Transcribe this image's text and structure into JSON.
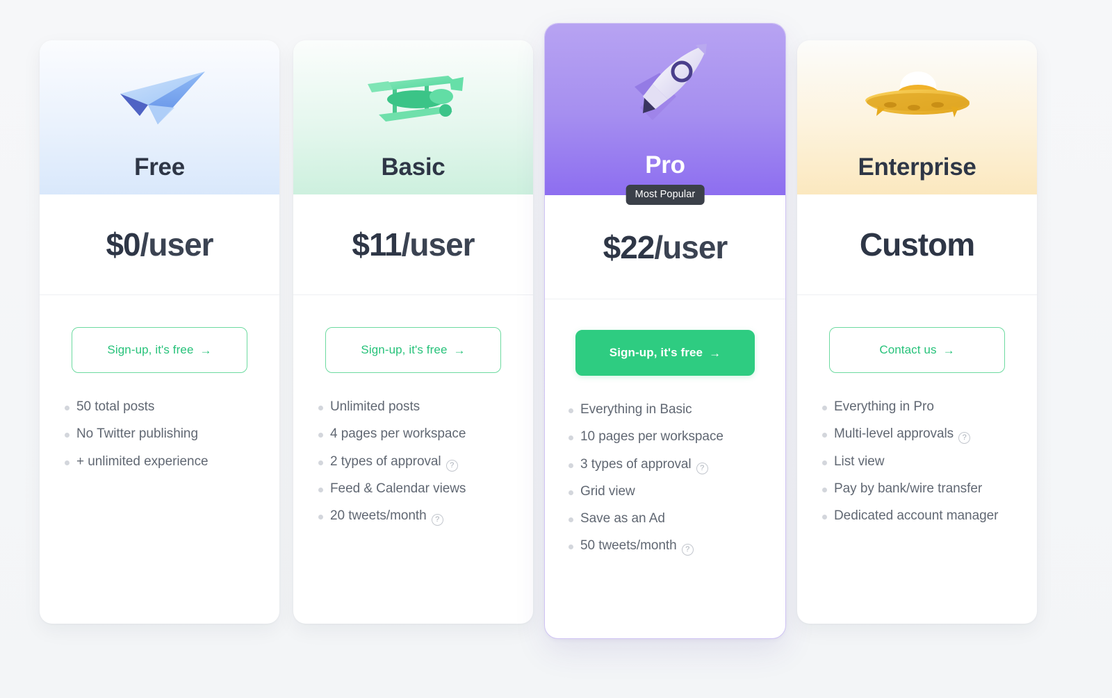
{
  "page": {
    "background_color": "#f4f6f8",
    "accent_green": "#2ecc81",
    "accent_purple": "#8d6ef0",
    "badge_color": "#3b4049"
  },
  "plans": [
    {
      "id": "free",
      "name": "Free",
      "icon": "paper-plane-icon",
      "price_amount": "$0",
      "price_unit": "/user",
      "featured": false,
      "badge": null,
      "cta_label": "Sign-up, it's free",
      "cta_arrow": "→",
      "cta_style": "outline",
      "features": [
        {
          "text": "50 total posts",
          "help": false
        },
        {
          "text": "No Twitter publishing",
          "help": false
        },
        {
          "text": "+ unlimited experience",
          "help": false
        }
      ]
    },
    {
      "id": "basic",
      "name": "Basic",
      "icon": "biplane-icon",
      "price_amount": "$11",
      "price_unit": "/user",
      "featured": false,
      "badge": null,
      "cta_label": "Sign-up, it's free",
      "cta_arrow": "→",
      "cta_style": "outline",
      "features": [
        {
          "text": "Unlimited posts",
          "help": false
        },
        {
          "text": "4 pages per workspace",
          "help": false
        },
        {
          "text": "2 types of approval",
          "help": true
        },
        {
          "text": "Feed & Calendar views",
          "help": false
        },
        {
          "text": "20 tweets/month",
          "help": true
        }
      ]
    },
    {
      "id": "pro",
      "name": "Pro",
      "icon": "rocket-icon",
      "price_amount": "$22",
      "price_unit": "/user",
      "featured": true,
      "badge": "Most Popular",
      "cta_label": "Sign-up, it's free",
      "cta_arrow": "→",
      "cta_style": "solid",
      "features": [
        {
          "text": "Everything in Basic",
          "help": false
        },
        {
          "text": "10 pages per workspace",
          "help": false
        },
        {
          "text": "3 types of approval",
          "help": true
        },
        {
          "text": "Grid view",
          "help": false
        },
        {
          "text": "Save as an Ad",
          "help": false
        },
        {
          "text": "50 tweets/month",
          "help": true
        }
      ]
    },
    {
      "id": "enterprise",
      "name": "Enterprise",
      "icon": "ufo-icon",
      "price_amount": "Custom",
      "price_unit": "",
      "featured": false,
      "badge": null,
      "cta_label": "Contact us",
      "cta_arrow": "→",
      "cta_style": "outline",
      "features": [
        {
          "text": "Everything in Pro",
          "help": false
        },
        {
          "text": "Multi-level approvals",
          "help": true
        },
        {
          "text": "List view",
          "help": false
        },
        {
          "text": "Pay by bank/wire transfer",
          "help": false
        },
        {
          "text": "Dedicated account manager",
          "help": false
        }
      ]
    }
  ],
  "help_icon_glyph": "?"
}
